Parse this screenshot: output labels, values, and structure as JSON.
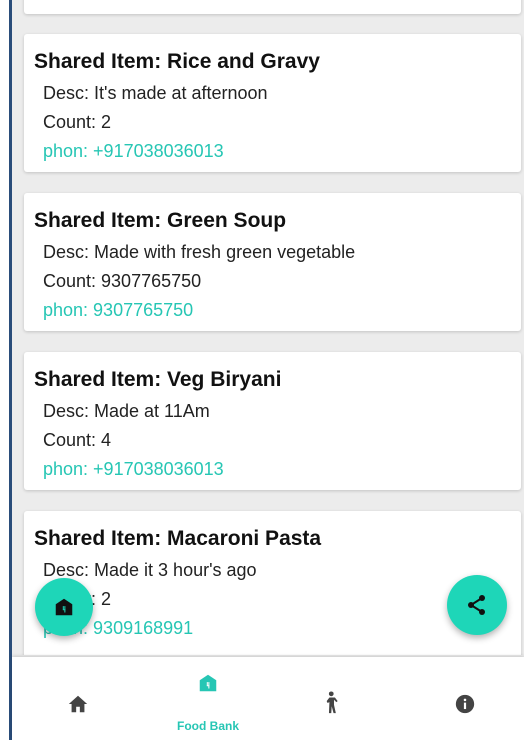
{
  "items": [
    {
      "title": "Shared Item: Rice and Gravy",
      "desc": "Desc: It's made at afternoon",
      "count": "Count: 2",
      "phone": "phon: +917038036013"
    },
    {
      "title": "Shared Item: Green Soup",
      "desc": "Desc: Made with fresh green vegetable",
      "count": "Count: 9307765750",
      "phone": "phon: 9307765750"
    },
    {
      "title": "Shared Item: Veg Biryani",
      "desc": "Desc: Made at 11Am",
      "count": "Count: 4",
      "phone": "phon: +917038036013"
    },
    {
      "title": "Shared Item: Macaroni Pasta",
      "desc": "Desc: Made it 3 hour's ago",
      "count": "Count: 2",
      "phone": "phon: 9309168991"
    }
  ],
  "fabs": {
    "left_icon": "food-bank-icon",
    "right_icon": "share-icon"
  },
  "nav": {
    "items": [
      {
        "icon": "home-icon",
        "label": ""
      },
      {
        "icon": "food-bank-icon",
        "label": "Food Bank"
      },
      {
        "icon": "person-icon",
        "label": ""
      },
      {
        "icon": "info-icon",
        "label": ""
      }
    ],
    "active_index": 1
  },
  "colors": {
    "accent": "#26c6b4",
    "fab": "#1ed6b8",
    "icon_inactive": "#444444"
  }
}
